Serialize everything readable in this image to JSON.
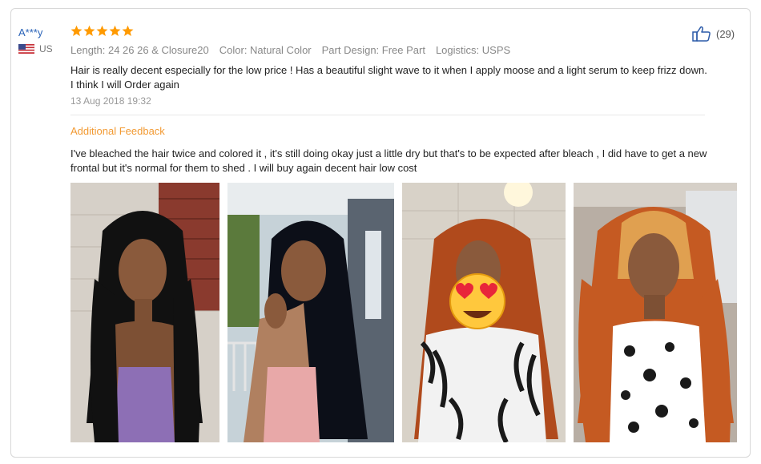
{
  "review": {
    "reviewer_name": "A***y",
    "country": "US",
    "rating": 5,
    "likes": "(29)",
    "meta": [
      "Length: 24 26 26 & Closure20",
      "Color: Natural Color",
      "Part Design: Free Part",
      "Logistics: USPS"
    ],
    "text": "Hair is really decent especially for the low price ! Has a beautiful slight wave to it when I apply moose and a light serum to keep frizz down. I think I will Order again",
    "date": "13 Aug 2018 19:32"
  },
  "additional_feedback": {
    "title": "Additional Feedback",
    "text": "I've bleached the hair twice and colored it , it's still doing okay just a little dry but that's to be expected after bleach , I did have to get a new frontal but it's normal for them to shed . I will buy again decent hair low cost"
  },
  "photos": [
    {
      "name": "review-photo-1",
      "hair_color": "#111111",
      "bg": "#cfc8c0"
    },
    {
      "name": "review-photo-2",
      "hair_color": "#0c0f18",
      "bg": "#b9c7cf"
    },
    {
      "name": "review-photo-3",
      "hair_color": "#b04a1c",
      "bg": "#d8d2c8"
    },
    {
      "name": "review-photo-4",
      "hair_color": "#c55a22",
      "bg": "#c0b6ac"
    }
  ],
  "colors": {
    "star": "#ff9a00",
    "accent": "#f29a33",
    "link": "#2a63b8"
  },
  "icons": [
    "us-flag-icon",
    "star-icon",
    "thumbs-up-icon",
    "heart-eyes-emoji"
  ]
}
